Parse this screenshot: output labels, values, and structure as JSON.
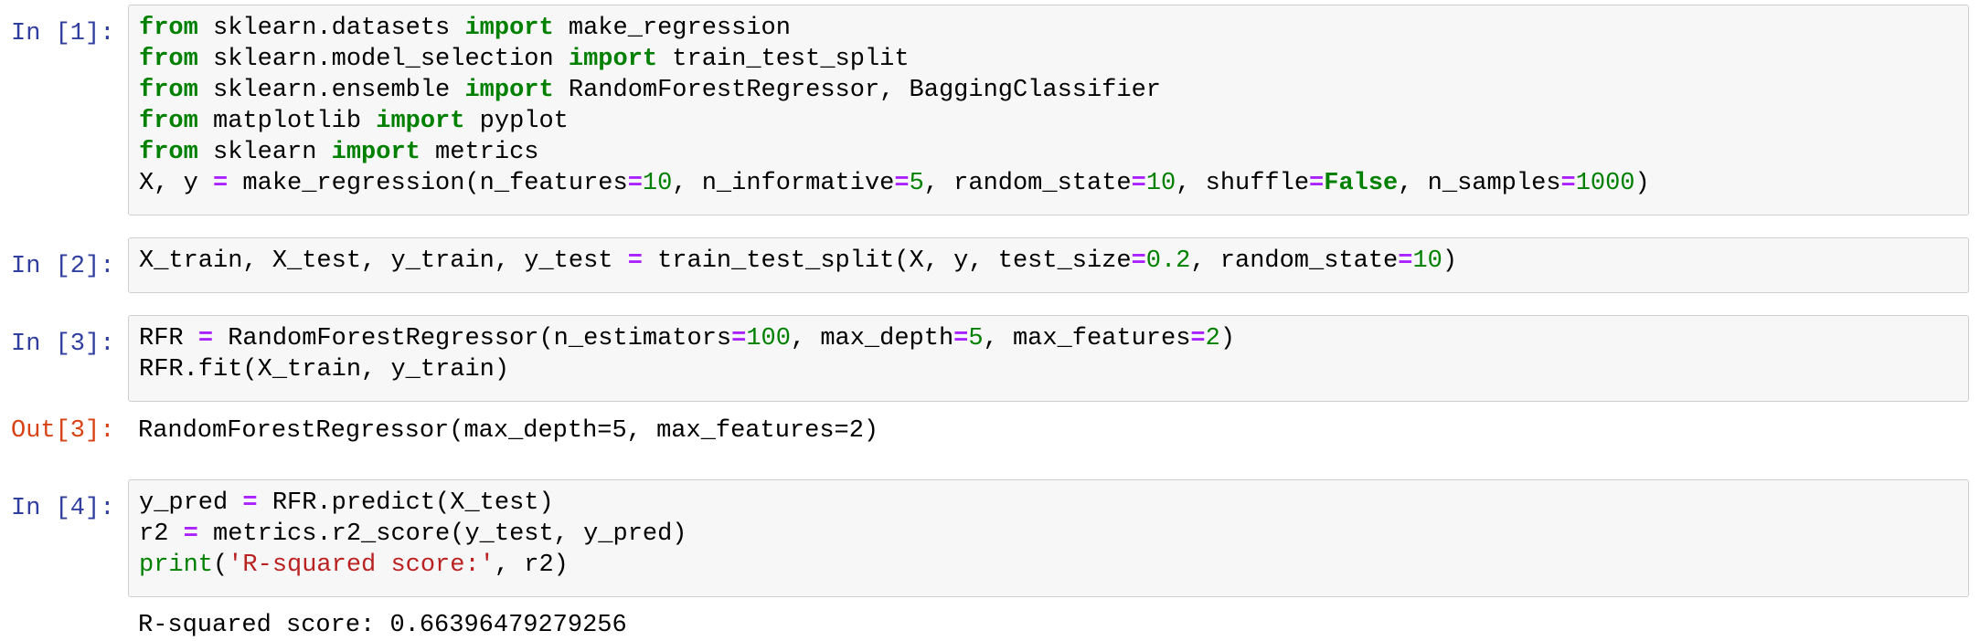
{
  "cells": [
    {
      "prompt": "In [1]:",
      "lines": [
        [
          {
            "t": "from",
            "c": "kw"
          },
          {
            "t": " sklearn.datasets "
          },
          {
            "t": "import",
            "c": "kw"
          },
          {
            "t": " make_regression"
          }
        ],
        [
          {
            "t": "from",
            "c": "kw"
          },
          {
            "t": " sklearn.model_selection "
          },
          {
            "t": "import",
            "c": "kw"
          },
          {
            "t": " train_test_split"
          }
        ],
        [
          {
            "t": "from",
            "c": "kw"
          },
          {
            "t": " sklearn.ensemble "
          },
          {
            "t": "import",
            "c": "kw"
          },
          {
            "t": " RandomForestRegressor, BaggingClassifier"
          }
        ],
        [
          {
            "t": "from",
            "c": "kw"
          },
          {
            "t": " matplotlib "
          },
          {
            "t": "import",
            "c": "kw"
          },
          {
            "t": " pyplot"
          }
        ],
        [
          {
            "t": "from",
            "c": "kw"
          },
          {
            "t": " sklearn "
          },
          {
            "t": "import",
            "c": "kw"
          },
          {
            "t": " metrics"
          }
        ],
        [
          {
            "t": "X, y "
          },
          {
            "t": "=",
            "c": "op"
          },
          {
            "t": " make_regression(n_features"
          },
          {
            "t": "=",
            "c": "op"
          },
          {
            "t": "10",
            "c": "num"
          },
          {
            "t": ", n_informative"
          },
          {
            "t": "=",
            "c": "op"
          },
          {
            "t": "5",
            "c": "num"
          },
          {
            "t": ", random_state"
          },
          {
            "t": "=",
            "c": "op"
          },
          {
            "t": "10",
            "c": "num"
          },
          {
            "t": ", shuffle"
          },
          {
            "t": "=",
            "c": "op"
          },
          {
            "t": "False",
            "c": "kw"
          },
          {
            "t": ", n_samples"
          },
          {
            "t": "=",
            "c": "op"
          },
          {
            "t": "1000",
            "c": "num"
          },
          {
            "t": ")"
          }
        ]
      ]
    },
    {
      "prompt": "In [2]:",
      "lines": [
        [
          {
            "t": "X_train, X_test, y_train, y_test "
          },
          {
            "t": "=",
            "c": "op"
          },
          {
            "t": " train_test_split(X, y, test_size"
          },
          {
            "t": "=",
            "c": "op"
          },
          {
            "t": "0.2",
            "c": "num"
          },
          {
            "t": ", random_state"
          },
          {
            "t": "=",
            "c": "op"
          },
          {
            "t": "10",
            "c": "num"
          },
          {
            "t": ")"
          }
        ]
      ]
    },
    {
      "prompt": "In [3]:",
      "lines": [
        [
          {
            "t": "RFR "
          },
          {
            "t": "=",
            "c": "op"
          },
          {
            "t": " RandomForestRegressor(n_estimators"
          },
          {
            "t": "=",
            "c": "op"
          },
          {
            "t": "100",
            "c": "num"
          },
          {
            "t": ", max_depth"
          },
          {
            "t": "=",
            "c": "op"
          },
          {
            "t": "5",
            "c": "num"
          },
          {
            "t": ", max_features"
          },
          {
            "t": "=",
            "c": "op"
          },
          {
            "t": "2",
            "c": "num"
          },
          {
            "t": ")"
          }
        ],
        [
          {
            "t": "RFR.fit(X_train, y_train)"
          }
        ]
      ],
      "out_prompt": "Out[3]:",
      "output": "RandomForestRegressor(max_depth=5, max_features=2)"
    },
    {
      "prompt": "In [4]:",
      "lines": [
        [
          {
            "t": "y_pred "
          },
          {
            "t": "=",
            "c": "op"
          },
          {
            "t": " RFR.predict(X_test)"
          }
        ],
        [
          {
            "t": "r2 "
          },
          {
            "t": "=",
            "c": "op"
          },
          {
            "t": " metrics.r2_score(y_test, y_pred)"
          }
        ],
        [
          {
            "t": "print",
            "c": "bi"
          },
          {
            "t": "("
          },
          {
            "t": "'R-squared score:'",
            "c": "str"
          },
          {
            "t": ", r2)"
          }
        ]
      ],
      "output": "R-squared score: 0.66396479279256"
    }
  ]
}
